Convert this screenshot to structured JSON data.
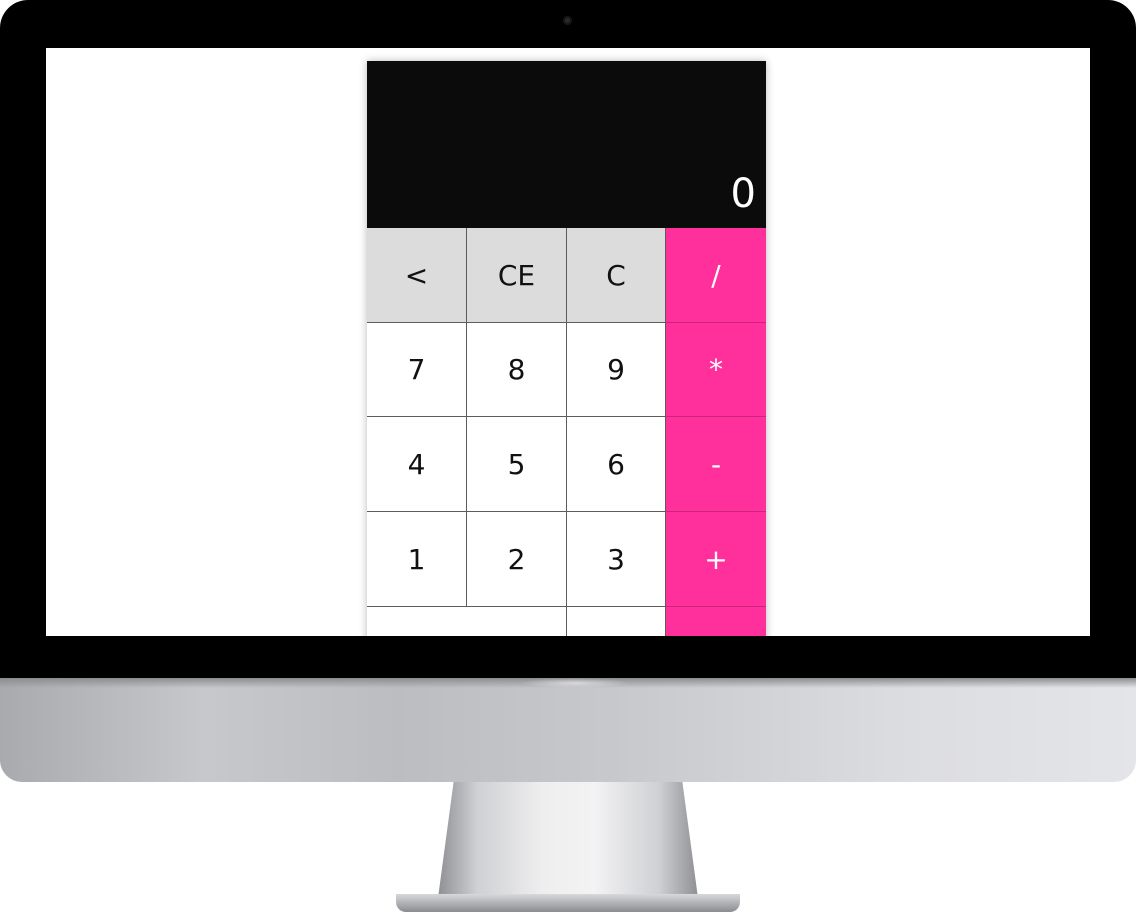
{
  "device": {
    "type": "iMac",
    "screen_background": "#ffffff"
  },
  "calculator": {
    "display": {
      "value": "0",
      "background": "#0b0b0b",
      "text_color": "#ffffff"
    },
    "colors": {
      "function_key": "#dcdcdc",
      "number_key": "#ffffff",
      "operator_key": "#ff2f9b",
      "operator_text": "#ffffff"
    },
    "keys": {
      "backspace": "<",
      "clear_entry": "CE",
      "clear": "C",
      "divide": "/",
      "seven": "7",
      "eight": "8",
      "nine": "9",
      "multiply": "*",
      "four": "4",
      "five": "5",
      "six": "6",
      "subtract": "-",
      "one": "1",
      "two": "2",
      "three": "3",
      "add": "+",
      "row5_wide": "",
      "row5_mid": "",
      "row5_op": ""
    }
  }
}
